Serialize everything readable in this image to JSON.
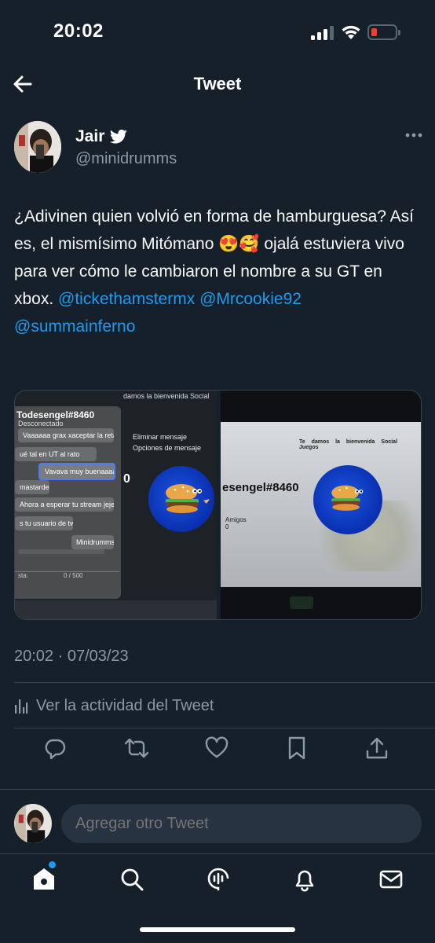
{
  "status_bar": {
    "time": "20:02"
  },
  "header": {
    "title": "Tweet"
  },
  "author": {
    "name": "Jair",
    "handle": "@minidrumms"
  },
  "tweet": {
    "text_parts": [
      "¿Adivinen quien volvió en forma de hamburguesa?  Así es, el mismísimo Mitómano 😍🥰 ojalá estuviera vivo para ver cómo le cambiaron el nombre a su GT en xbox. ",
      "@tickethamstermx",
      " ",
      "@Mrcookie92",
      " ",
      "@summainferno"
    ],
    "timestamp": "20:02 · 07/03/23"
  },
  "media_left": {
    "gamertag": "Todesengel#8460",
    "status": "Desconectado",
    "messages": [
      "Vaaaaaa grax xaceptar la reta",
      "ué tal en UT al rato",
      "Vavava muy buenaaaa",
      "mastarde",
      "Ahora a esperar tu stream jeje",
      "s tu usuario de tw",
      "Minidrumms"
    ],
    "counter": "0 / 500",
    "input_label": "sta:",
    "menu_header": "damos la bienvenida   Social",
    "menu_items": [
      "Eliminar mensaje",
      "Opciones de mensaje"
    ],
    "partial_number": "0"
  },
  "media_right": {
    "tabs": "Te damos la bienvenida  Social  Juegos",
    "gamertag": "esengel#8460",
    "friends_label": "Amigos",
    "friends_count": "0"
  },
  "activity": {
    "label": "Ver la actividad del Tweet"
  },
  "reply": {
    "placeholder": "Agregar otro Tweet"
  },
  "tabs": [
    "home-tab",
    "search-tab",
    "spaces-tab",
    "notifications-tab",
    "messages-tab"
  ],
  "colors": {
    "background": "#15202b",
    "accent": "#1d9bf0",
    "muted": "#8b98a5",
    "border": "#38444d"
  }
}
